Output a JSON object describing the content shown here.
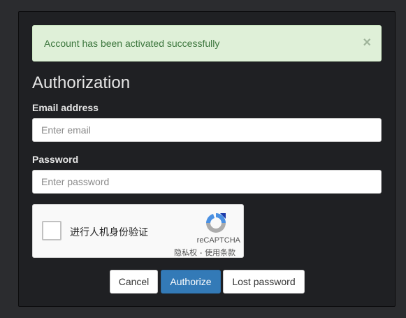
{
  "alert": {
    "message": "Account has been activated successfully",
    "close_glyph": "×",
    "color": "#3c763d",
    "background": "#dff0d8"
  },
  "form": {
    "title": "Authorization",
    "email": {
      "label": "Email address",
      "value": "",
      "placeholder": "Enter email"
    },
    "password": {
      "label": "Password",
      "value": "",
      "placeholder": "Enter password"
    }
  },
  "captcha": {
    "checkbox_label": "进行人机身份验证",
    "brand": "reCAPTCHA",
    "links": "隐私权 - 使用条款",
    "icon": "recaptcha-logo-icon"
  },
  "buttons": {
    "cancel": "Cancel",
    "authorize": "Authorize",
    "lost_password": "Lost password",
    "primary_color": "#337ab7"
  }
}
